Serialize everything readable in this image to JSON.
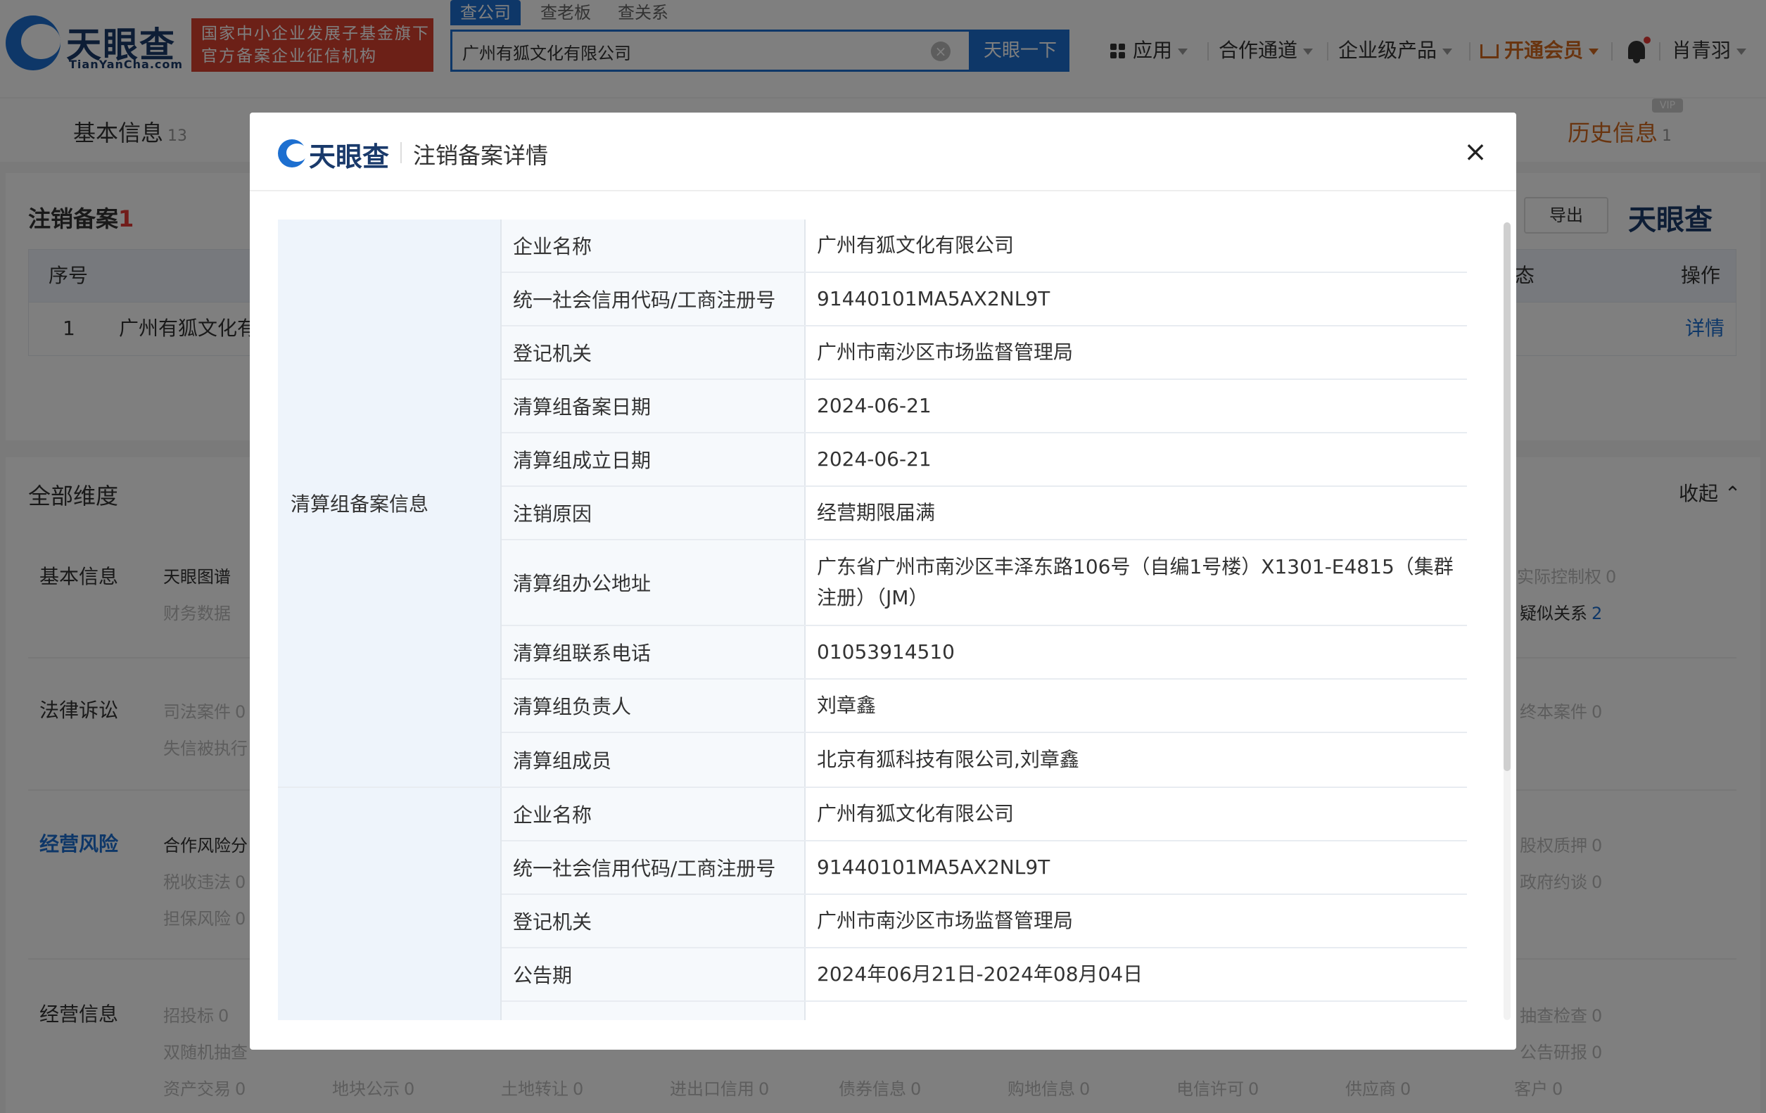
{
  "header": {
    "logo_cn": "天眼查",
    "logo_en": "TianYanCha.com",
    "slogan_line1": "国家中小企业发展子基金旗下",
    "slogan_line2": "官方备案企业征信机构",
    "search_tabs": [
      "查公司",
      "查老板",
      "查关系"
    ],
    "search_value": "广州有狐文化有限公司",
    "search_button": "天眼一下",
    "nav": {
      "apps": "应用",
      "partner": "合作通道",
      "enterprise": "企业级产品",
      "vip": "开通会员",
      "user": "肖青羽"
    }
  },
  "background": {
    "tab_basic": "基本信息",
    "tab_basic_count": "13",
    "tab_history": "历史信息",
    "tab_history_count": "1",
    "vip_tag": "VIP",
    "section_title": "注销备案",
    "section_count": "1",
    "export": "导出",
    "brand": "天眼查",
    "table": {
      "col_index": "序号",
      "col_status": "态",
      "col_action": "操作",
      "row_index": "1",
      "row_company": "广州有狐文化有",
      "row_status": "",
      "row_action": "详情"
    },
    "dims_title": "全部维度",
    "collapse": "收起",
    "dims": {
      "basic": "基本信息",
      "legal": "法律诉讼",
      "risk": "经营风险",
      "ops": "经营信息",
      "basic_items": [
        {
          "label": "天眼图谱",
          "num": ""
        },
        {
          "label": "财务数据",
          "num": ""
        },
        {
          "label": "实际控制权",
          "num": "0"
        },
        {
          "label": "疑似关系",
          "num": "2"
        }
      ],
      "legal_items": [
        {
          "label": "司法案件",
          "num": "0"
        },
        {
          "label": "失信被执行",
          "num": ""
        },
        {
          "label": "终本案件",
          "num": "0"
        }
      ],
      "risk_items": [
        {
          "label": "合作风险分",
          "num": ""
        },
        {
          "label": "税收违法",
          "num": "0"
        },
        {
          "label": "担保风险",
          "num": "0"
        },
        {
          "label": "股权质押",
          "num": "0"
        },
        {
          "label": "政府约谈",
          "num": "0"
        }
      ],
      "ops_items": [
        {
          "label": "招投标",
          "num": "0"
        },
        {
          "label": "双随机抽查",
          "num": ""
        },
        {
          "label": "抽查检查",
          "num": "0"
        },
        {
          "label": "公告研报",
          "num": "0"
        },
        {
          "label": "资产交易",
          "num": "0"
        },
        {
          "label": "地块公示",
          "num": "0"
        },
        {
          "label": "土地转让",
          "num": "0"
        },
        {
          "label": "进出口信用",
          "num": "0"
        },
        {
          "label": "债券信息",
          "num": "0"
        },
        {
          "label": "购地信息",
          "num": "0"
        },
        {
          "label": "电信许可",
          "num": "0"
        },
        {
          "label": "供应商",
          "num": "0"
        },
        {
          "label": "客户",
          "num": "0"
        }
      ]
    }
  },
  "modal": {
    "logo_text": "天眼查",
    "title": "注销备案详情",
    "close": "×",
    "group1": {
      "label": "清算组备案信息",
      "rows": [
        {
          "key": "企业名称",
          "value": "广州有狐文化有限公司"
        },
        {
          "key": "统一社会信用代码/工商注册号",
          "value": "91440101MA5AX2NL9T"
        },
        {
          "key": "登记机关",
          "value": "广州市南沙区市场监督管理局"
        },
        {
          "key": "清算组备案日期",
          "value": "2024-06-21"
        },
        {
          "key": "清算组成立日期",
          "value": "2024-06-21"
        },
        {
          "key": "注销原因",
          "value": "经营期限届满"
        },
        {
          "key": "清算组办公地址",
          "value": "广东省广州市南沙区丰泽东路106号（自编1号楼）X1301-E4815（集群注册）（JM）"
        },
        {
          "key": "清算组联系电话",
          "value": "01053914510"
        },
        {
          "key": "清算组负责人",
          "value": "刘章鑫"
        },
        {
          "key": "清算组成员",
          "value": "北京有狐科技有限公司,刘章鑫"
        }
      ]
    },
    "group2": {
      "label": "",
      "rows": [
        {
          "key": "企业名称",
          "value": "广州有狐文化有限公司"
        },
        {
          "key": "统一社会信用代码/工商注册号",
          "value": "91440101MA5AX2NL9T"
        },
        {
          "key": "登记机关",
          "value": "广州市南沙区市场监督管理局"
        },
        {
          "key": "公告期",
          "value": "2024年06月21日-2024年08月04日"
        }
      ]
    }
  }
}
